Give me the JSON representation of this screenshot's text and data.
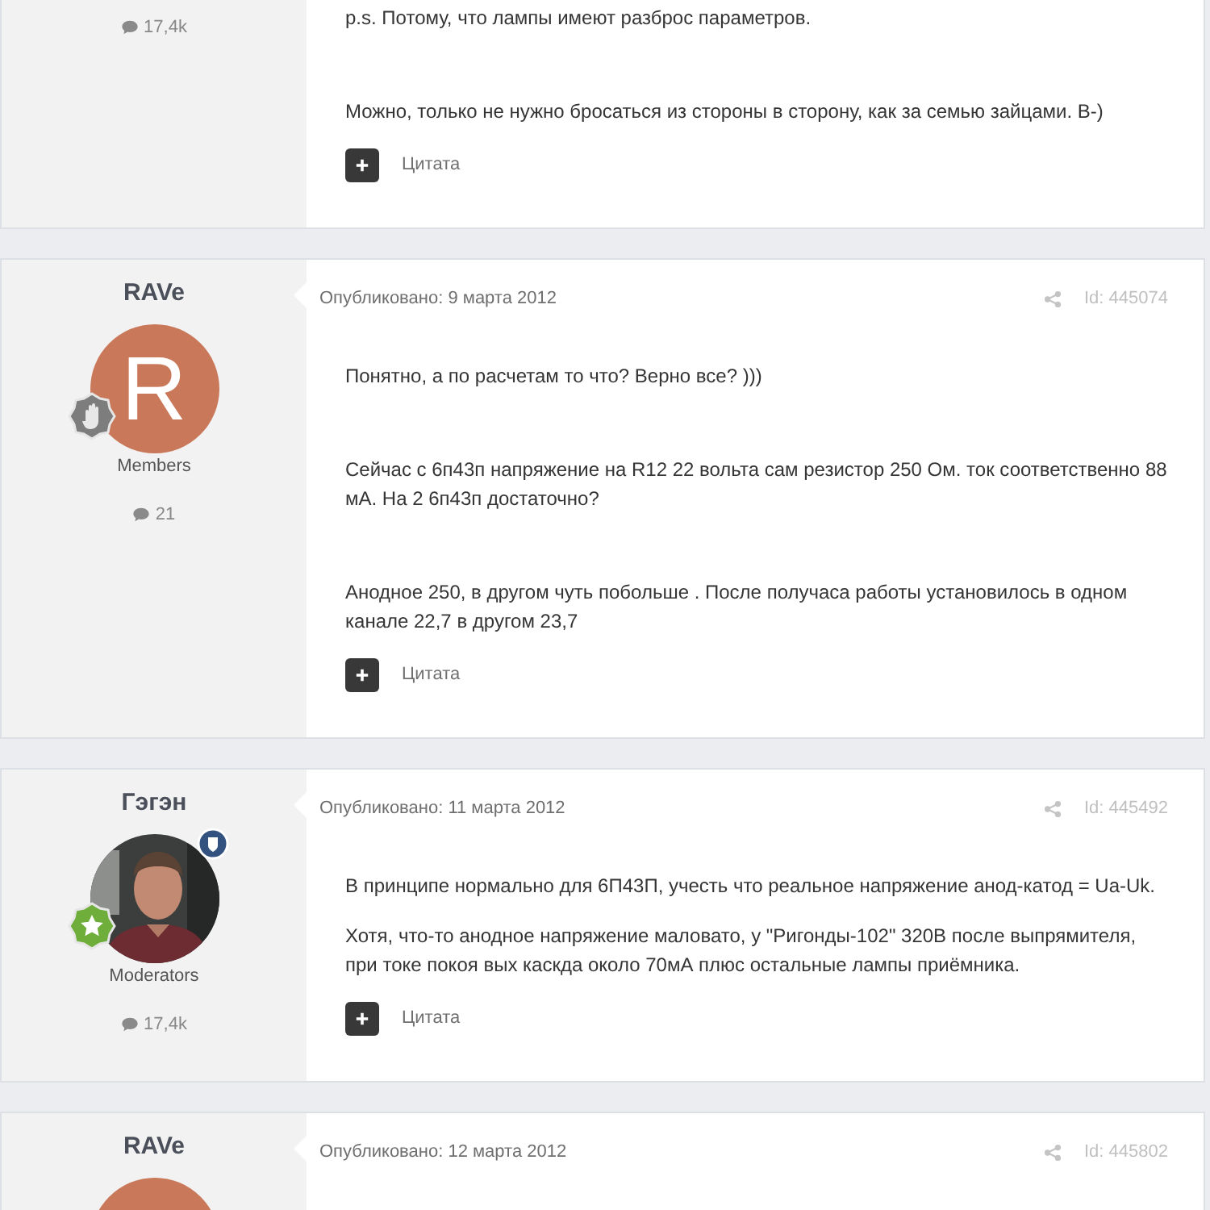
{
  "posts": [
    {
      "author": {
        "post_count": "17,4k"
      },
      "paragraphs": [
        {
          "kind": "lead",
          "text": "p.s. Потому, что лампы имеют разброс параметров."
        },
        {
          "kind": "after_blank",
          "text": "Можно, только не нужно бросаться из стороны в сторону, как за семью зайцами. В-)"
        }
      ],
      "quote_label": "Цитата"
    },
    {
      "author": {
        "name": "RAVe",
        "avatar": {
          "kind": "letter",
          "letter": "R",
          "color": "#c9785a"
        },
        "badges": [
          {
            "kind": "hand"
          }
        ],
        "group": "Members",
        "post_count": "21"
      },
      "date": "Опубликовано: 9 марта 2012",
      "id": "Id: 445074",
      "paragraphs": [
        {
          "kind": "lead",
          "text": "Понятно, а по расчетам то что? Верно все? )))"
        },
        {
          "kind": "after_blank",
          "text": "Сейчас с 6п43п напряжение на R12 22 вольта сам резистор 250 Ом. ток соответственно 88 мА. На 2 6п43п достаточно?"
        },
        {
          "kind": "after_blank",
          "text": "Анодное 250, в другом чуть побольше . После получаса работы установилось в одном канале 22,7 в другом 23,7"
        }
      ],
      "quote_label": "Цитата"
    },
    {
      "author": {
        "name": "Гэгэн",
        "badges": [
          {
            "kind": "shield"
          },
          {
            "kind": "star"
          }
        ],
        "group": "Moderators",
        "post_count": "17,4k"
      },
      "date": "Опубликовано: 11 марта 2012",
      "id": "Id: 445492",
      "paragraphs": [
        {
          "kind": "lead",
          "text": "В принципе нормально для 6П43П, учесть что реальное напряжение анод-катод = Ua-Uk."
        },
        {
          "kind": "plain",
          "text": "Хотя, что-то анодное напряжение маловато, у \"Ригонды-102\" 320В после выпрямителя, при токе покоя вых каскда около 70мА плюс остальные лампы приёмника."
        }
      ],
      "quote_label": "Цитата"
    },
    {
      "author": {
        "name": "RAVe",
        "avatar": {
          "kind": "letter",
          "color": "#c9785a"
        }
      },
      "date": "Опубликовано: 12 марта 2012",
      "id": "Id: 445802"
    }
  ]
}
